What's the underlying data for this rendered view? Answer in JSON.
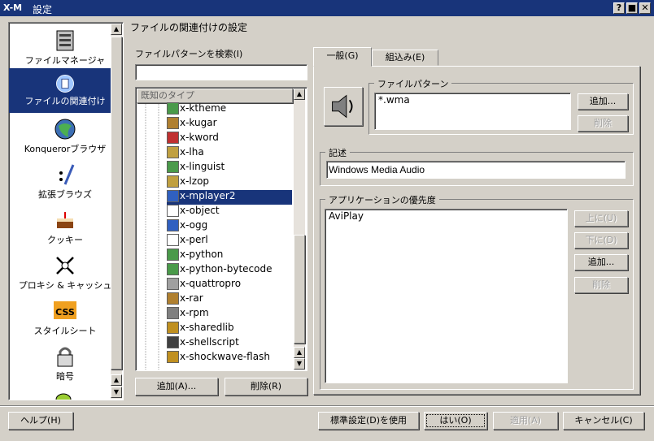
{
  "window": {
    "title": "設定",
    "icon_text": "X-M"
  },
  "header": {
    "title": "ファイルの関連付けの設定"
  },
  "sidebar": {
    "items": [
      {
        "label": "ファイルマネージャ",
        "icon": "file-manager-icon"
      },
      {
        "label": "ファイルの関連付け",
        "icon": "file-association-icon",
        "selected": true
      },
      {
        "label": "Konquerorブラウザ",
        "icon": "konqueror-browser-icon"
      },
      {
        "label": "拡張ブラウズ",
        "icon": "enhanced-browsing-icon"
      },
      {
        "label": "クッキー",
        "icon": "cookie-cake-icon"
      },
      {
        "label": "プロキシ & キャッシュ",
        "icon": "proxy-cache-icon"
      },
      {
        "label": "スタイルシート",
        "icon": "css-stylesheet-icon"
      },
      {
        "label": "暗号",
        "icon": "crypto-lock-icon"
      }
    ]
  },
  "search": {
    "label": "ファイルパターンを検索(I)",
    "value": ""
  },
  "tree": {
    "header": "既知のタイプ",
    "items": [
      "x-ktheme",
      "x-kugar",
      "x-kword",
      "x-lha",
      "x-linguist",
      "x-lzop",
      "x-mplayer2",
      "x-object",
      "x-ogg",
      "x-perl",
      "x-python",
      "x-python-bytecode",
      "x-quattropro",
      "x-rar",
      "x-rpm",
      "x-sharedlib",
      "x-shellscript",
      "x-shockwave-flash"
    ],
    "selected": "x-mplayer2"
  },
  "tree_buttons": {
    "add": "追加(A)...",
    "remove": "削除(R)"
  },
  "tabs": [
    {
      "label": "一般(G)",
      "active": true
    },
    {
      "label": "組込み(E)"
    }
  ],
  "file_patterns": {
    "title": "ファイルパターン",
    "items": [
      "*.wma"
    ],
    "add": "追加...",
    "remove": "削除"
  },
  "description": {
    "title": "記述",
    "value": "Windows Media Audio"
  },
  "app_priority": {
    "title": "アプリケーションの優先度",
    "items": [
      "AviPlay"
    ],
    "up": "上に(U)",
    "down": "下に(D)",
    "add": "追加...",
    "remove": "削除"
  },
  "footer": {
    "help": "ヘルプ(H)",
    "defaults": "標準設定(D)を使用",
    "ok": "はい(O)",
    "apply": "適用(A)",
    "cancel": "キャンセル(C)"
  },
  "colors": {
    "titlebar": "#18347a",
    "selection": "#18347a",
    "face": "#d4d0c8"
  }
}
